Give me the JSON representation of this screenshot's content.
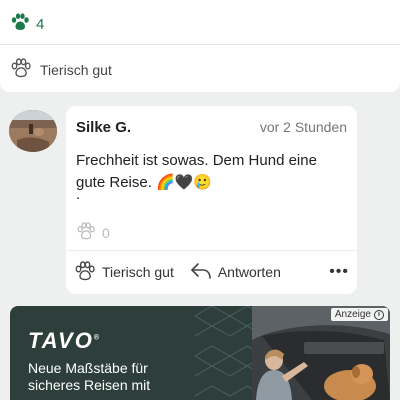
{
  "top_post": {
    "paw_count": "4",
    "reaction_label": "Tierisch gut"
  },
  "comment": {
    "author": "Silke G.",
    "time": "vor 2 Stunden",
    "text": "Frechheit ist sowas. Dem Hund eine gute Reise. 🌈🖤🥲",
    "text_line2": ".",
    "like_count": "0",
    "actions": {
      "like_label": "Tierisch gut",
      "reply_label": "Antworten",
      "more_label": "•••"
    }
  },
  "ad": {
    "brand": "TAVO",
    "registered_mark": "®",
    "label": "Anzeige",
    "info_symbol": "i",
    "headline": "Neue Maßstäbe für sicheres Reisen mit"
  },
  "colors": {
    "accent_green": "#1e7a4b",
    "ad_background": "#2d3e3b"
  },
  "icons": {
    "paw_filled": "paw-icon",
    "paw_outline": "paw-outline-icon",
    "reply": "reply-arrow-icon",
    "more": "more-dots-icon",
    "info": "info-icon"
  }
}
